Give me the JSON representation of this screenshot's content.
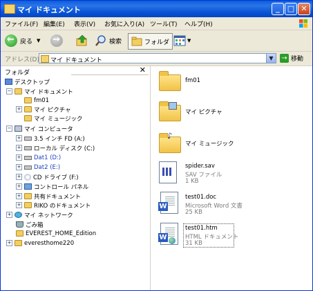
{
  "window": {
    "title": "マイ ドキュメント",
    "buttons": {
      "minimize": "_",
      "maximize": "□",
      "close": "✕"
    }
  },
  "menu": [
    "ファイル(F)",
    "編集(E)",
    "表示(V)",
    "お気に入り(A)",
    "ツール(T)",
    "ヘルプ(H)"
  ],
  "toolbar": {
    "back": "戻る",
    "search": "検索",
    "folders": "フォルダ"
  },
  "address": {
    "label": "アドレス(D)",
    "value": "マイ ドキュメント",
    "go": "移動"
  },
  "folders_pane": {
    "title": "フォルダ",
    "close": "✕",
    "tree": {
      "desktop": "デスクトップ",
      "mydocs": "マイ ドキュメント",
      "fm01": "fm01",
      "mypictures": "マイ ピクチャ",
      "mymusic": "マイ ミュージック",
      "mycomputer": "マイ コンピュータ",
      "floppy": "3.5 インチ FD (A:)",
      "localdisk": "ローカル ディスク (C:)",
      "dat1": "Dat1 (D:)",
      "dat2": "Dat2 (E:)",
      "cd": "CD ドライブ (F:)",
      "cpanel": "コントロール パネル",
      "shareddocs": "共有ドキュメント",
      "rikodocs": "RIKO のドキュメント",
      "network": "マイ ネットワーク",
      "trash": "ごみ箱",
      "everest": "EVEREST_HOME_Edition",
      "everesthome": "everesthome220"
    }
  },
  "content": {
    "items": [
      {
        "name": "fm01"
      },
      {
        "name": "マイ ピクチャ"
      },
      {
        "name": "マイ ミュージック"
      },
      {
        "name": "spider.sav",
        "type": "SAV ファイル",
        "size": "1 KB"
      },
      {
        "name": "test01.doc",
        "type": "Microsoft Word 文書",
        "size": "25 KB"
      },
      {
        "name": "test01.htm",
        "type": "HTML ドキュメント",
        "size": "31 KB"
      }
    ]
  },
  "colors": {
    "titlebar": "#0a5fdc",
    "chrome": "#ece9d8",
    "selection_blue": "#1a40c0"
  }
}
